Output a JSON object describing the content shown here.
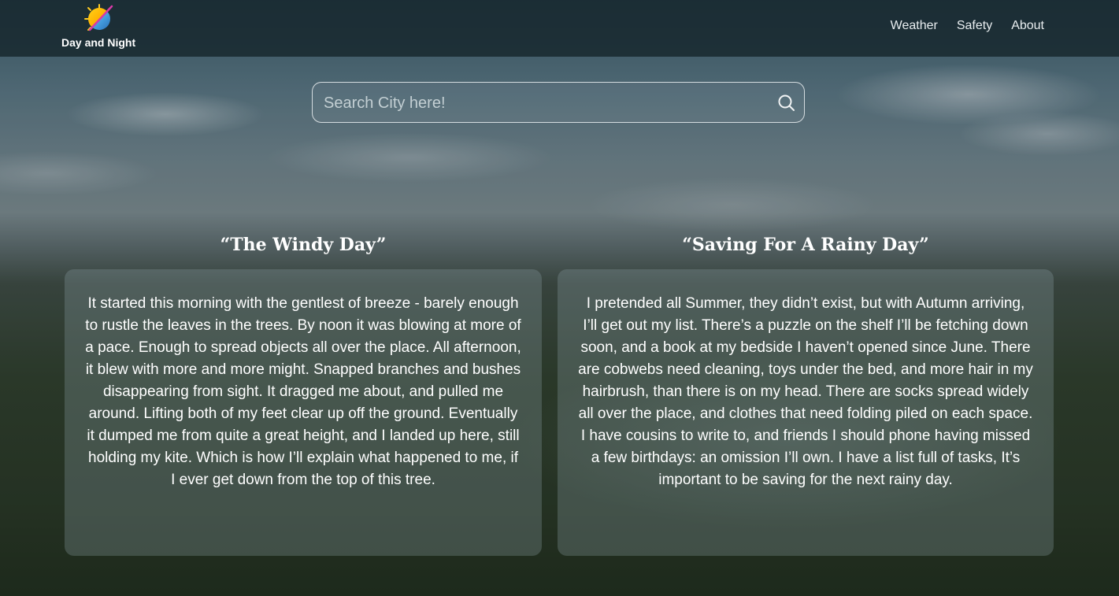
{
  "brand": {
    "name": "Day and Night",
    "logo_icon": "sun-moon-logo-icon"
  },
  "nav": {
    "links": [
      "Weather",
      "Safety",
      "About"
    ]
  },
  "search": {
    "placeholder": "Search City here!",
    "icon": "search-icon"
  },
  "poems": [
    {
      "title": "“The Windy Day”",
      "body": "It started this morning with the gentlest of breeze - barely enough to rustle the leaves in the trees. By noon it was blowing at more of a pace. Enough to spread objects all over the place. All afternoon, it blew with more and more might. Snapped branches and bushes disappearing from sight. It dragged me about, and pulled me around. Lifting both of my feet clear up off the ground. Eventually it dumped me from quite a great height, and I landed up here, still holding my kite. Which is how I’ll explain what happened to me, if I ever get down from the top of this tree."
    },
    {
      "title": "“Saving For A Rainy Day”",
      "body": "I pretended all Summer, they didn’t exist, but with Autumn arriving, I’ll get out my list. There’s a puzzle on the shelf I’ll be fetching down soon, and a book at my bedside I haven’t opened since June. There are cobwebs need cleaning, toys under the bed, and more hair in my hairbrush, than there is on my head. There are socks spread widely all over the place, and clothes that need folding piled on each space. I have cousins to write to, and friends I should phone having missed a few birthdays: an omission I’ll own. I have a list full of tasks, It’s important to be saving for the next rainy day."
    }
  ],
  "colors": {
    "navbar": "#16262c",
    "card": "#8ca0a5",
    "text": "#ffffff"
  }
}
